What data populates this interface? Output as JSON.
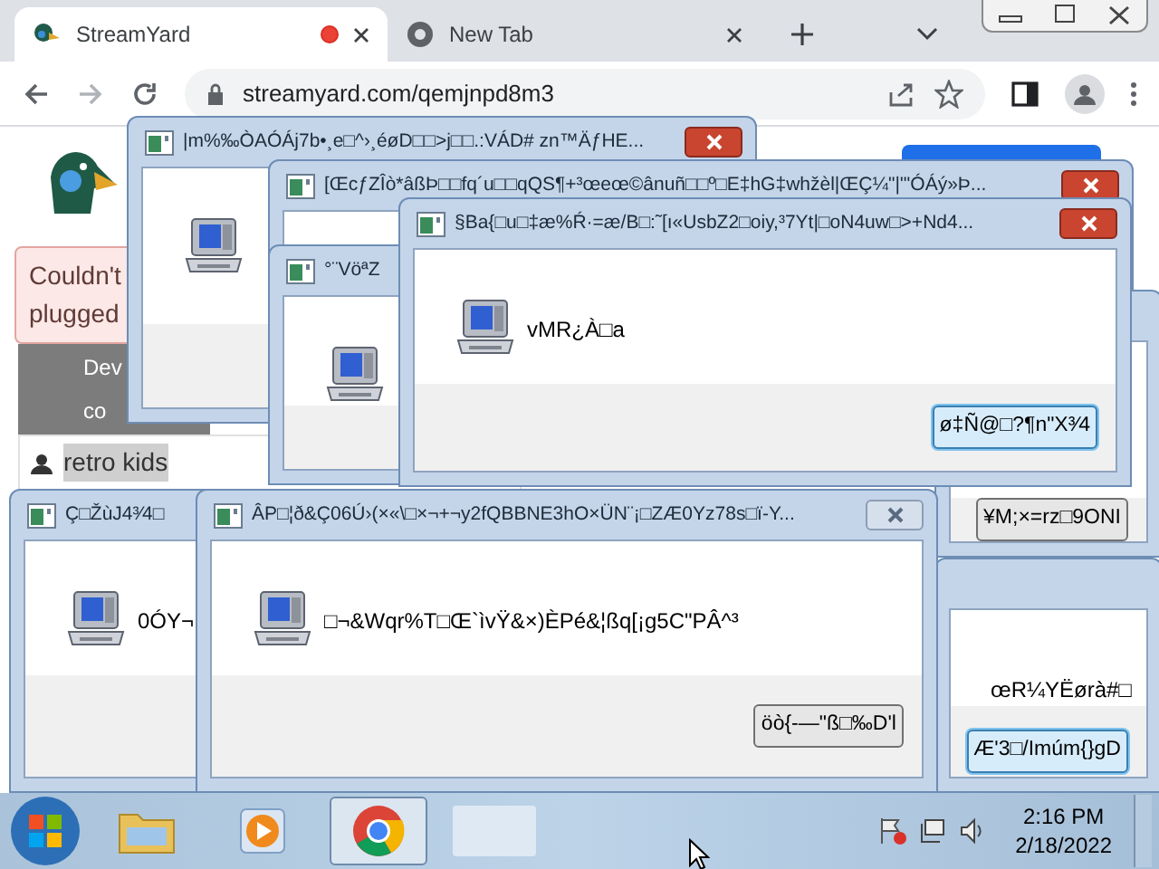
{
  "browser": {
    "tabs": [
      {
        "title": "StreamYard",
        "selected": true,
        "recording": true
      },
      {
        "title": "New Tab",
        "selected": false,
        "recording": false
      }
    ],
    "address": "streamyard.com/qemjnpd8m3"
  },
  "page": {
    "alert_lines": [
      "Couldn't",
      "plugged"
    ],
    "device_lines": [
      "Dev",
      "co"
    ],
    "user": "retro kids"
  },
  "dialogs": [
    {
      "title": "|m%‰ÒAÓÁj7b•¸e□^›¸éøD□□>j□□.:VÁD# zn™ÄƒHE...",
      "close": {
        "highlighted": true
      }
    },
    {
      "title": "[ŒcƒZÎò*âßÞ□□fq´u□□qQS¶+³œeœ©ânuñ□□º□E‡hG‡whžèl|ŒÇ¼\"|'\"ÓÁý»Þ...",
      "close": {
        "highlighted": true
      }
    },
    {
      "title": "°¨VöªZ"
    },
    {
      "title": "§Ba{□u□‡æ%Ŕ·=æ/B□:˜[ı«UsbZ2□oiy,³7Yt|□oN4uw□>+Nd4...",
      "close": {
        "highlighted": true
      },
      "message": "vMR¿À□a",
      "button": {
        "label": "ø‡Ñ@□?¶n\"X³⁄4",
        "focused": true
      }
    },
    {
      "button": {
        "label": "¥M;×=rz□9ONI",
        "focused": false
      }
    },
    {
      "message": "œR¼YËørà#□",
      "button": {
        "label": "Æ'3□/Imúm{}gD",
        "focused": true
      }
    },
    {
      "title": "Ç□ŽùJ4³⁄4□",
      "message": "0ÓY¬"
    },
    {
      "title": "ÂP□¦ð&Ç06Ú›(×«\\□×¬+¬y2fQBBNE3hO×ÜN¨¡□ZÆ0Yz78s□ï-Y...",
      "close": {
        "highlighted": false
      },
      "message": "□¬&Wqr%T□Œ`ìvŸ&×)ÈPé&¦ßq[¡g5C\"PÂ^³",
      "button": {
        "label": "öò{-—\"ß□‰D'l",
        "focused": false
      }
    }
  ],
  "taskbar": {
    "items": [
      {
        "kind": "folder",
        "selected": false
      },
      {
        "kind": "media",
        "selected": false
      },
      {
        "kind": "chrome",
        "selected": true
      },
      {
        "kind": "window",
        "selected": false
      }
    ],
    "time": "2:16 PM",
    "date": "2/18/2022"
  }
}
